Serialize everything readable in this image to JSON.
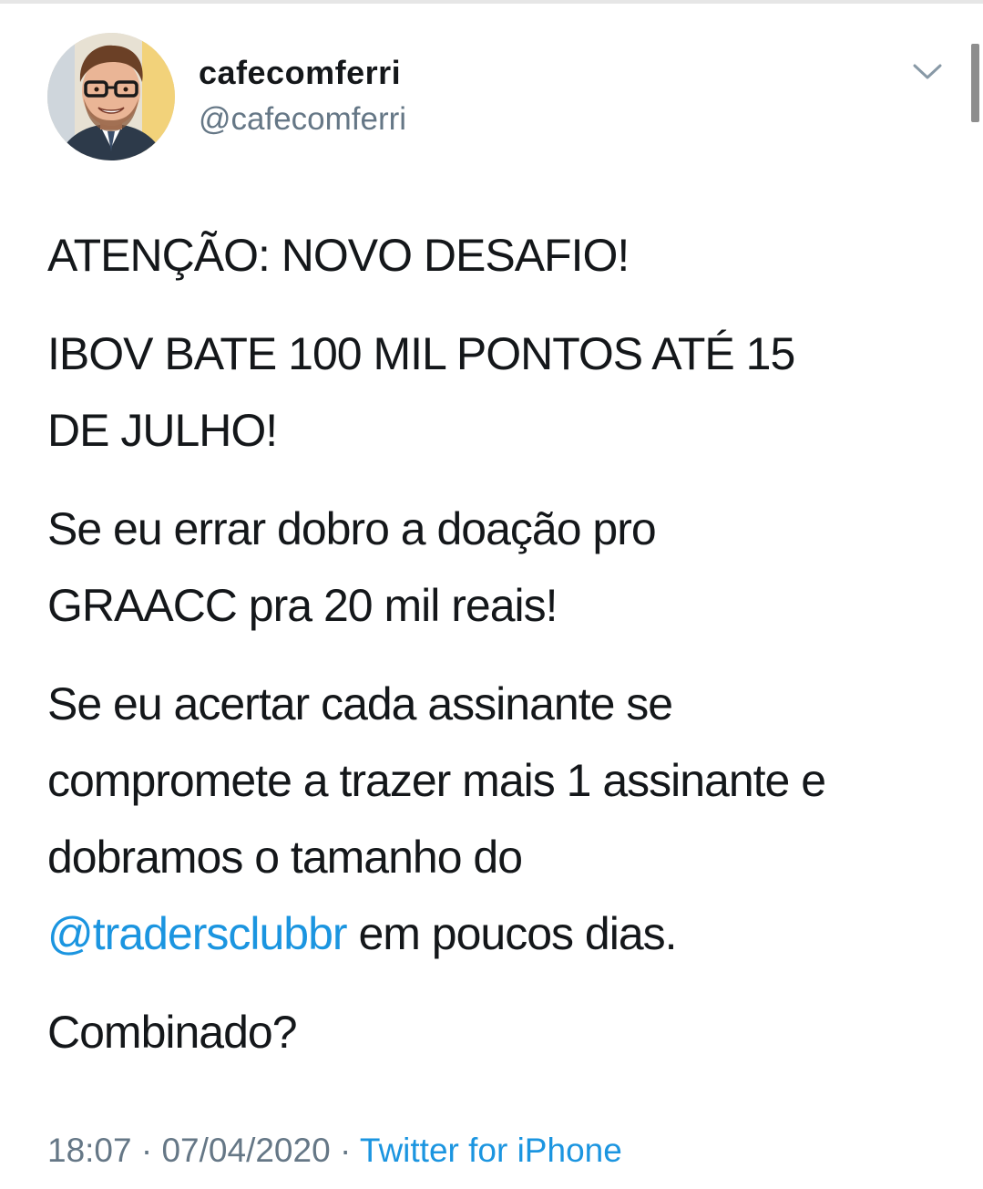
{
  "user": {
    "display_name": "cafecomferri",
    "handle": "@cafecomferri"
  },
  "header": {
    "menu_icon": "chevron-down-icon",
    "avatar_icon": "profile-photo"
  },
  "tweet": {
    "line1": "ATENÇÃO: NOVO DESAFIO!",
    "line2a": "IBOV BATE 100 MIL PONTOS ATÉ 15",
    "line2b": "DE JULHO!",
    "line3a": "Se eu errar dobro a doação pro",
    "line3b": "GRAACC pra 20 mil reais!",
    "line4a": "Se eu acertar cada assinante se",
    "line4b": "compromete a trazer mais 1 assinante e",
    "line4c": "dobramos o tamanho do",
    "mention": "@tradersclubbr",
    "line4d": " em poucos dias.",
    "line5": "Combinado?"
  },
  "meta": {
    "time": "18:07",
    "separator": " · ",
    "date": "07/04/2020",
    "source": "Twitter for iPhone"
  },
  "colors": {
    "link": "#1b95e0",
    "secondary_text": "#657786",
    "primary_text": "#14171a"
  }
}
